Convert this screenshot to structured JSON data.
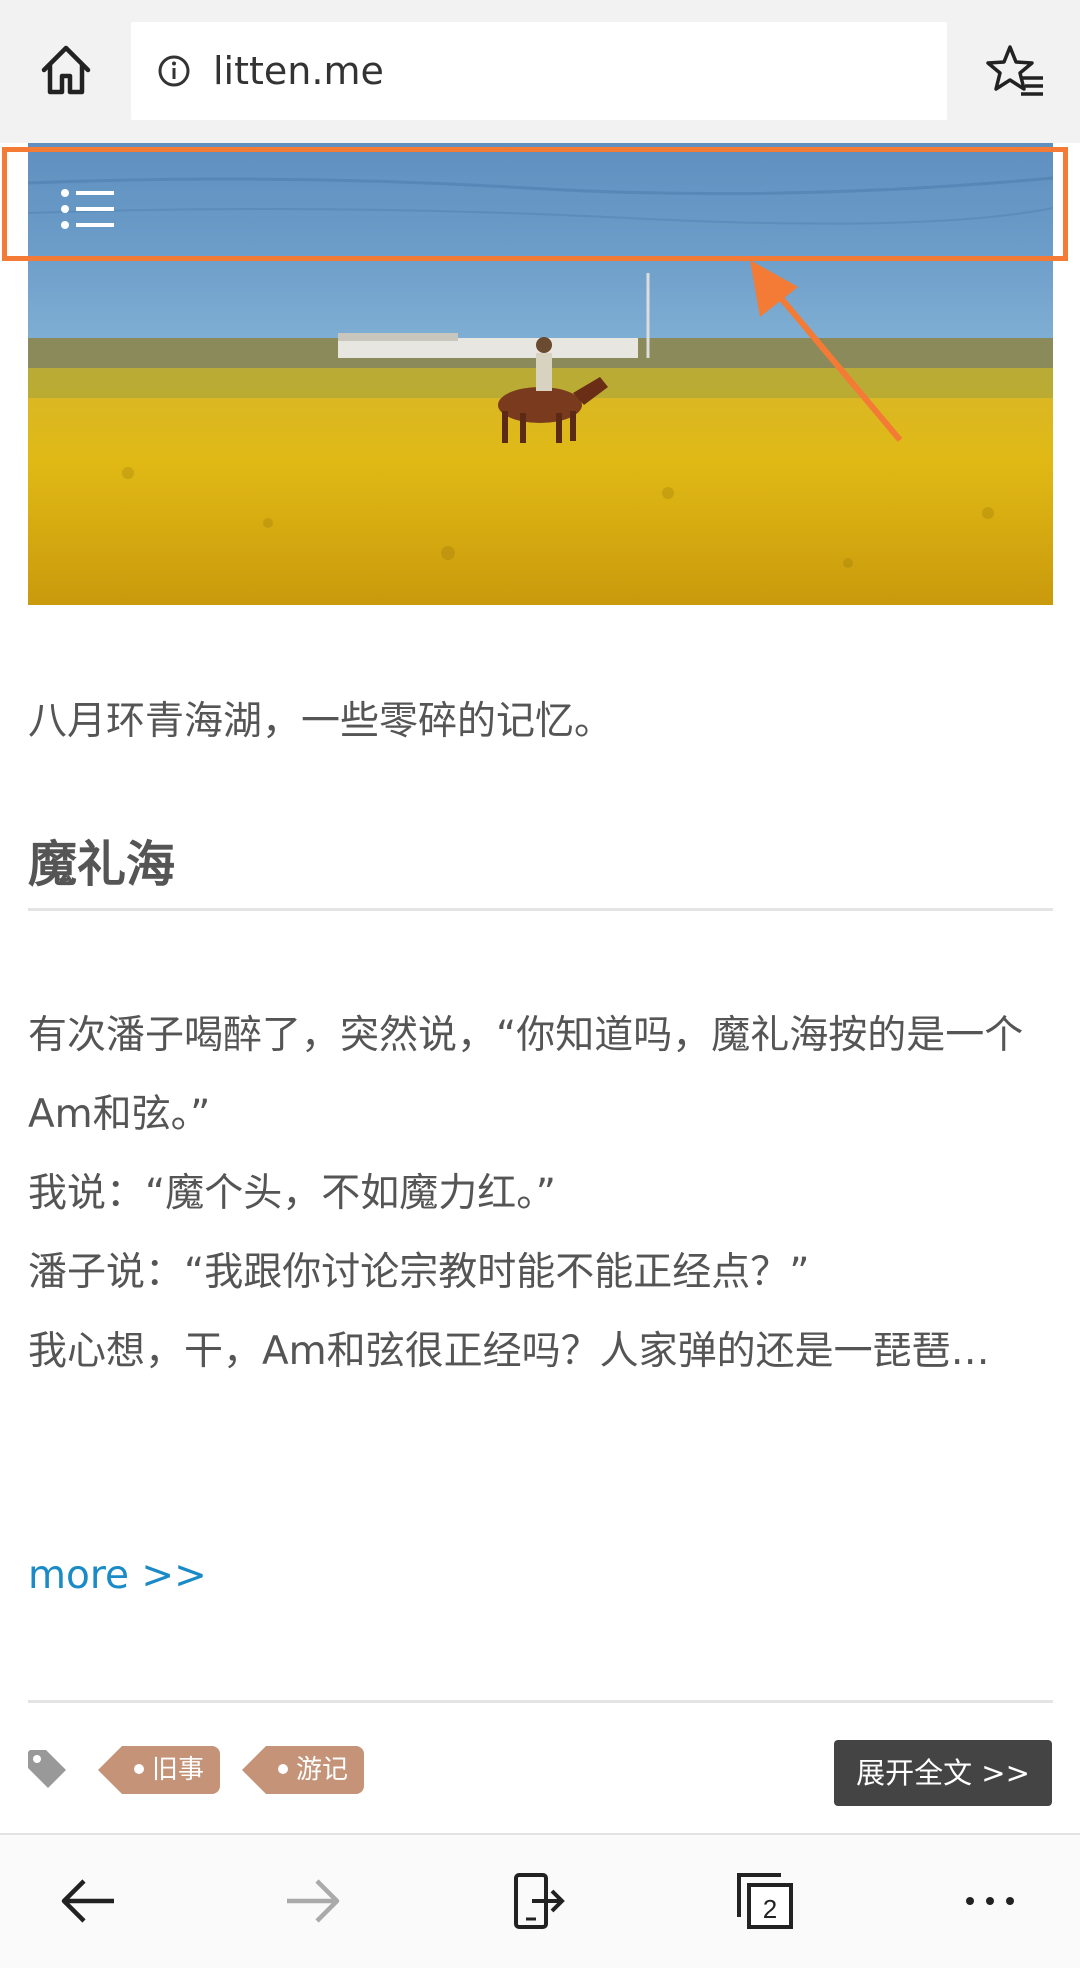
{
  "browser": {
    "url": "litten.me",
    "tab_count": "2"
  },
  "article": {
    "intro": "八月环青海湖，一些零碎的记忆。",
    "section_title": "魔礼海",
    "paragraphs": [
      "有次潘子喝醉了，突然说，“你知道吗，魔礼海按的是一个Am和弦。”",
      "我说：“魔个头，不如魔力红。”",
      "潘子说：“我跟你讨论宗教时能不能正经点？”",
      "我心想，干，Am和弦很正经吗？人家弹的还是一琵琶…"
    ],
    "more_label": "more >>",
    "tags": [
      "旧事",
      "游记"
    ],
    "expand_label": "展开全文 >>"
  },
  "colors": {
    "annotation": "#f47b35",
    "tag": "#c49378",
    "link": "#1a8bc6",
    "button": "#444444"
  },
  "icons": [
    "home-icon",
    "info-icon",
    "favorites-icon",
    "menu-icon",
    "tag-icon",
    "back-icon",
    "forward-icon",
    "share-icon",
    "tabs-icon",
    "more-icon"
  ]
}
